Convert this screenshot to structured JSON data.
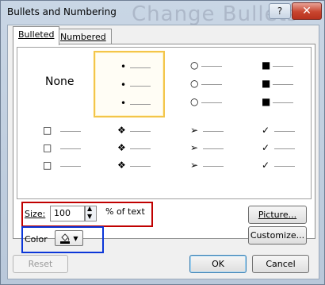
{
  "window": {
    "title": "Bullets and Numbering",
    "background_text": "Change Bullets",
    "help_label": "?",
    "close_label": "✕"
  },
  "tabs": [
    {
      "label": "Bulleted",
      "active": true
    },
    {
      "label": "Numbered",
      "active": false
    }
  ],
  "gallery": {
    "none_label": "None",
    "selected_index": 1,
    "styles": [
      "none",
      "small-dot",
      "hollow-circle",
      "filled-square",
      "hollow-square",
      "four-diamond",
      "arrowhead",
      "checkmark"
    ],
    "glyphs": {
      "small-dot": "•",
      "hollow-circle": "○",
      "filled-square": "■",
      "hollow-square": "□",
      "four-diamond": "❖",
      "arrowhead": "➢",
      "checkmark": "✓"
    }
  },
  "size": {
    "label": "Size:",
    "value": "100",
    "unit_label": "% of text"
  },
  "color": {
    "label": "Color",
    "swatch": "#000000"
  },
  "buttons": {
    "picture": "Picture...",
    "customize": "Customize...",
    "reset": "Reset",
    "ok": "OK",
    "cancel": "Cancel"
  },
  "colors": {
    "highlight_red": "#c00000",
    "highlight_blue": "#0b36d8",
    "selection": "#f3c54a"
  }
}
